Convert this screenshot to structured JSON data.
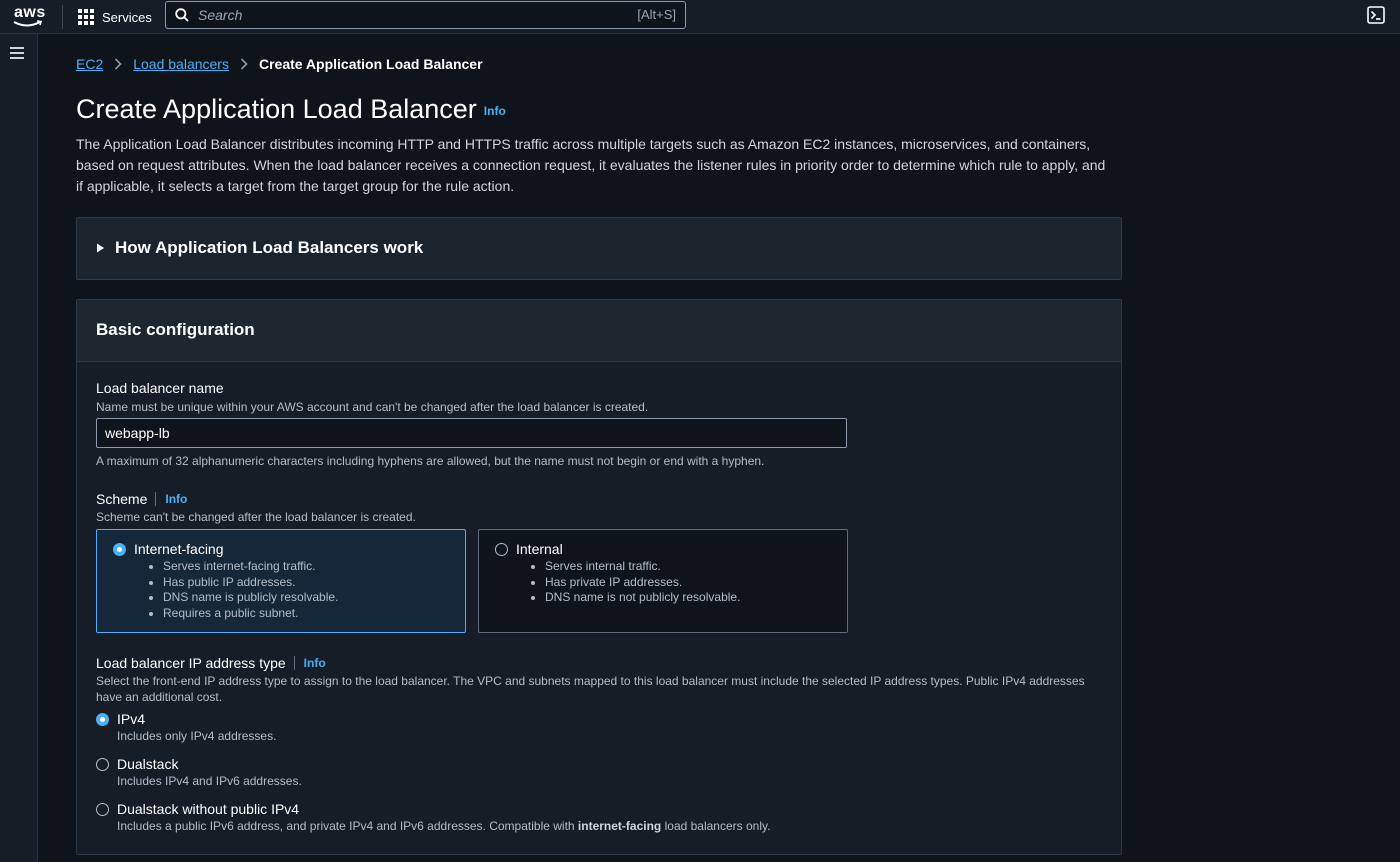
{
  "topnav": {
    "logo_text": "aws",
    "services_label": "Services",
    "search_placeholder": "Search",
    "search_shortcut": "[Alt+S]"
  },
  "breadcrumb": {
    "items": [
      "EC2",
      "Load balancers"
    ],
    "current": "Create Application Load Balancer"
  },
  "page": {
    "title": "Create Application Load Balancer",
    "info": "Info",
    "description": "The Application Load Balancer distributes incoming HTTP and HTTPS traffic across multiple targets such as Amazon EC2 instances, microservices, and containers, based on request attributes. When the load balancer receives a connection request, it evaluates the listener rules in priority order to determine which rule to apply, and if applicable, it selects a target from the target group for the rule action."
  },
  "how_panel": {
    "title": "How Application Load Balancers work"
  },
  "basic": {
    "title": "Basic configuration",
    "name": {
      "label": "Load balancer name",
      "description": "Name must be unique within your AWS account and can't be changed after the load balancer is created.",
      "value": "webapp-lb",
      "constraint": "A maximum of 32 alphanumeric characters including hyphens are allowed, but the name must not begin or end with a hyphen."
    },
    "scheme": {
      "label": "Scheme",
      "info": "Info",
      "description": "Scheme can't be changed after the load balancer is created.",
      "options": [
        {
          "label": "Internet-facing",
          "selected": true,
          "bullets": [
            "Serves internet-facing traffic.",
            "Has public IP addresses.",
            "DNS name is publicly resolvable.",
            "Requires a public subnet."
          ]
        },
        {
          "label": "Internal",
          "selected": false,
          "bullets": [
            "Serves internal traffic.",
            "Has private IP addresses.",
            "DNS name is not publicly resolvable."
          ]
        }
      ]
    },
    "ip_type": {
      "label": "Load balancer IP address type",
      "info": "Info",
      "description": "Select the front-end IP address type to assign to the load balancer. The VPC and subnets mapped to this load balancer must include the selected IP address types. Public IPv4 addresses have an additional cost.",
      "options": [
        {
          "label": "IPv4",
          "selected": true,
          "sub": "Includes only IPv4 addresses."
        },
        {
          "label": "Dualstack",
          "selected": false,
          "sub": "Includes IPv4 and IPv6 addresses."
        },
        {
          "label": "Dualstack without public IPv4",
          "selected": false,
          "sub_pre": "Includes a public IPv6 address, and private IPv4 and IPv6 addresses. Compatible with ",
          "sub_bold": "internet-facing",
          "sub_post": " load balancers only."
        }
      ]
    }
  },
  "colors": {
    "accent": "#4ab0f7",
    "background": "#0f141a",
    "panel": "#1b232d",
    "nav": "#161d26",
    "aws_smile": "#ff9900"
  },
  "icons": {
    "services": "grid-icon",
    "search": "search-icon",
    "cloudshell": "cloudshell-icon",
    "menu": "hamburger-icon",
    "breadcrumb_separator": "chevron-right-icon",
    "expand": "caret-right-icon"
  }
}
